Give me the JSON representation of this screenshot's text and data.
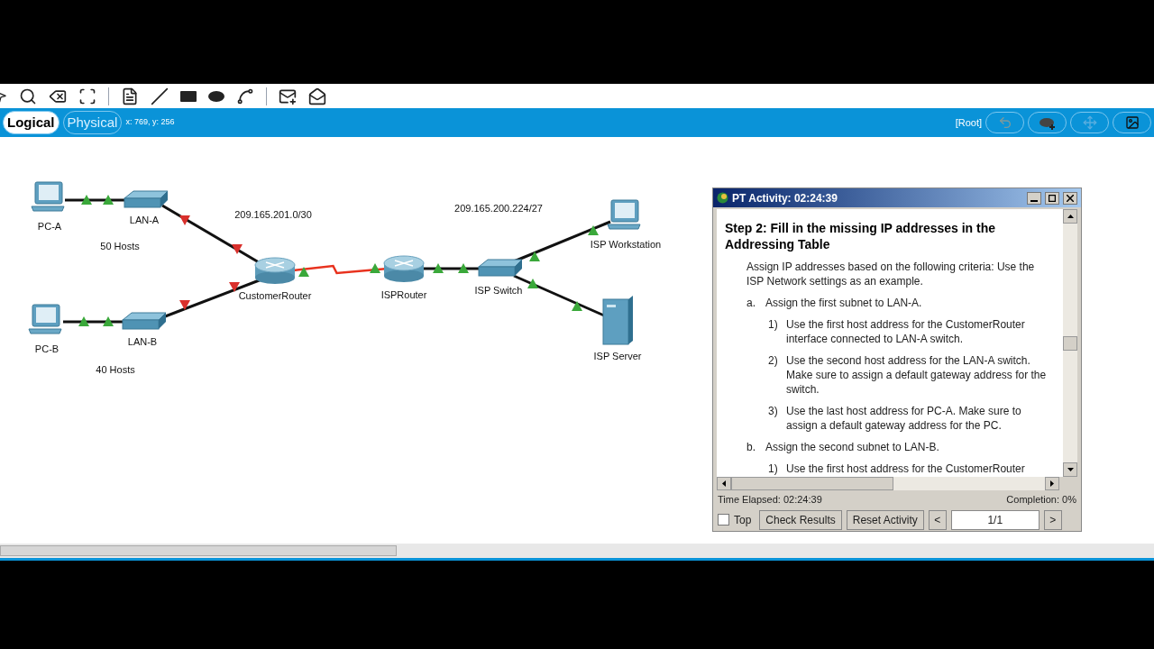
{
  "view_tabs": [
    {
      "label": "Logical",
      "selected": true
    },
    {
      "label": "Physical",
      "selected": false
    }
  ],
  "coordinates": "x: 769, y: 256",
  "root_label": "[Root]",
  "topology": {
    "devices": [
      {
        "kind": "pc",
        "label": "PC-A"
      },
      {
        "kind": "switch",
        "label": "LAN-A"
      },
      {
        "kind": "pc",
        "label": "PC-B"
      },
      {
        "kind": "switch",
        "label": "LAN-B"
      },
      {
        "kind": "router",
        "label": "CustomerRouter"
      },
      {
        "kind": "router",
        "label": "ISPRouter"
      },
      {
        "kind": "switch",
        "label": "ISP Switch"
      },
      {
        "kind": "pc",
        "label": "ISP Workstation"
      },
      {
        "kind": "server",
        "label": "ISP Server"
      }
    ],
    "notes": [
      "209.165.201.0/30",
      "209.165.200.224/27",
      "50 Hosts",
      "40 Hosts"
    ],
    "links": [
      {
        "kind": "ethernet",
        "end_a_up": true,
        "end_b_up": true
      },
      {
        "kind": "ethernet",
        "end_a_up": false,
        "end_b_up": false
      },
      {
        "kind": "ethernet",
        "end_a_up": true,
        "end_b_up": true
      },
      {
        "kind": "ethernet",
        "end_a_up": false,
        "end_b_up": false
      },
      {
        "kind": "serial",
        "end_a_up": true,
        "end_b_up": true
      },
      {
        "kind": "ethernet",
        "end_a_up": true,
        "end_b_up": true
      },
      {
        "kind": "ethernet",
        "end_a_up": true,
        "end_b_up": true
      },
      {
        "kind": "ethernet",
        "end_a_up": true,
        "end_b_up": true
      }
    ]
  },
  "activity": {
    "title": "PT Activity: 02:24:39",
    "heading": "Step 2: Fill in the missing IP addresses in the Addressing Table",
    "items": [
      {
        "kind": "intro",
        "text": "Assign IP addresses based on the following criteria: Use the ISP Network settings as an example."
      },
      {
        "kind": "letter",
        "marker": "a.",
        "text": "Assign the first subnet to LAN-A."
      },
      {
        "kind": "number",
        "marker": "1)",
        "text": "Use the first host address for the CustomerRouter interface connected to LAN-A switch."
      },
      {
        "kind": "number",
        "marker": "2)",
        "text": "Use the second host address for the LAN-A switch. Make sure to assign a default gateway address for the switch."
      },
      {
        "kind": "number",
        "marker": "3)",
        "text": "Use the last host address for PC-A. Make sure to assign a default gateway address for the PC."
      },
      {
        "kind": "letter",
        "marker": "b.",
        "text": "Assign the second subnet to LAN-B."
      },
      {
        "kind": "number",
        "marker": "1)",
        "text": "Use the first host address for the CustomerRouter"
      }
    ],
    "time_elapsed": "Time Elapsed: 02:24:39",
    "completion": "Completion: 0%",
    "top_checkbox": {
      "label": "Top",
      "checked": false
    },
    "buttons": [
      "Check Results",
      "Reset Activity"
    ],
    "prev": "<",
    "page": "1/1",
    "next": ">"
  }
}
